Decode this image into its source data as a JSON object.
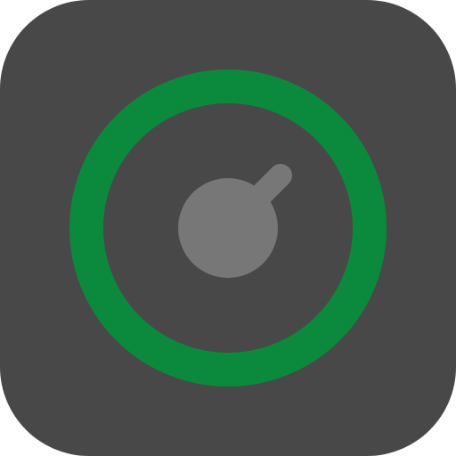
{
  "app_icon": {
    "name": "app-icon",
    "depicts": "dial-knob-icon",
    "colors": {
      "background": "#484848",
      "ring": "#0b8a3e",
      "knob": "#777777"
    }
  }
}
